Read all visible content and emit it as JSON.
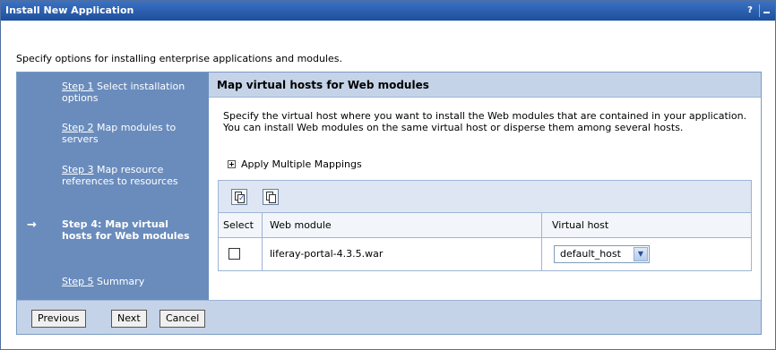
{
  "window": {
    "title": "Install New Application",
    "help_label": "?"
  },
  "intro": "Specify options for installing enterprise applications and modules.",
  "steps": [
    {
      "num": "Step 1",
      "text": " Select installation options",
      "current": false
    },
    {
      "num": "Step 2",
      "text": " Map modules to servers",
      "current": false
    },
    {
      "num": "Step 3",
      "text": " Map resource references to resources",
      "current": false
    },
    {
      "num": "",
      "text": "Step 4: Map virtual hosts for Web modules",
      "current": true
    },
    {
      "num": "Step 5",
      "text": " Summary",
      "current": false
    }
  ],
  "current_step_arrow": "→",
  "panel": {
    "title": "Map virtual hosts for Web modules",
    "description": "Specify the virtual host where you want to install the Web modules that are contained in your application. You can install Web modules on the same virtual host or disperse them among several hosts.",
    "apply_multiple": "Apply Multiple Mappings"
  },
  "table": {
    "headers": {
      "select": "Select",
      "module": "Web module",
      "host": "Virtual host"
    },
    "rows": [
      {
        "module": "liferay-portal-4.3.5.war",
        "host": "default_host",
        "selected": false
      }
    ]
  },
  "buttons": {
    "previous": "Previous",
    "next": "Next",
    "cancel": "Cancel"
  },
  "icons": {
    "select_all": "select-all-icon",
    "deselect_all": "deselect-all-icon",
    "dropdown": "chevron-down-icon",
    "expand": "plus-icon"
  },
  "colors": {
    "titlebar": "#1d4f9c",
    "steps_panel": "#6a8cbd",
    "header_band": "#c5d3e8"
  }
}
